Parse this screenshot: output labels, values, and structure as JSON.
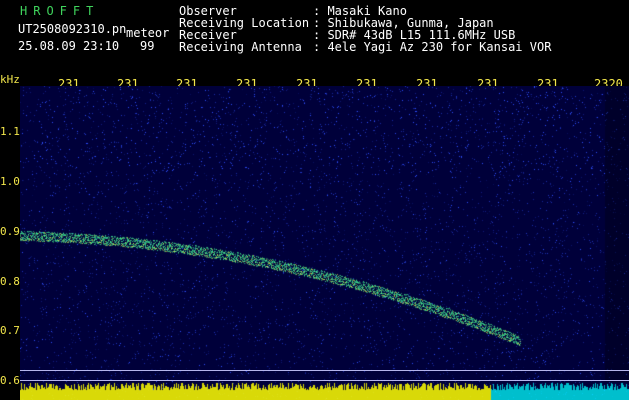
{
  "header": {
    "brand": "HROFFT",
    "filename": "UT2508092310.pn",
    "label_meteor": "meteor",
    "datetime": "25.08.09 23:10",
    "count": "99",
    "fields": [
      {
        "label": "Observer",
        "value": ": Masaki Kano"
      },
      {
        "label": "Receiving Location",
        "value": ": Shibukawa, Gunma, Japan"
      },
      {
        "label": "Receiver",
        "value": ": SDR# 43dB L15 111.6MHz USB"
      },
      {
        "label": "Receiving Antenna",
        "value": ": 4ele Yagi Az 230 for Kansai VOR"
      }
    ]
  },
  "spectrogram": {
    "y_unit": "kHz",
    "y_ticks": [
      "1.1",
      "1.0",
      "0.9",
      "0.8",
      "0.7",
      "0.6"
    ],
    "x_ticks": [
      "231",
      "231",
      "231",
      "231",
      "231",
      "231",
      "231",
      "231",
      "231",
      "2320"
    ],
    "colors": {
      "background": "#00003a",
      "noise": "#3050ff",
      "trace": "#46ff9a",
      "trace_hot": "#ffee44",
      "baseline": "#ffff00",
      "baseline_tail": "#00ffff",
      "tick_text": "#f2e64b"
    }
  }
}
